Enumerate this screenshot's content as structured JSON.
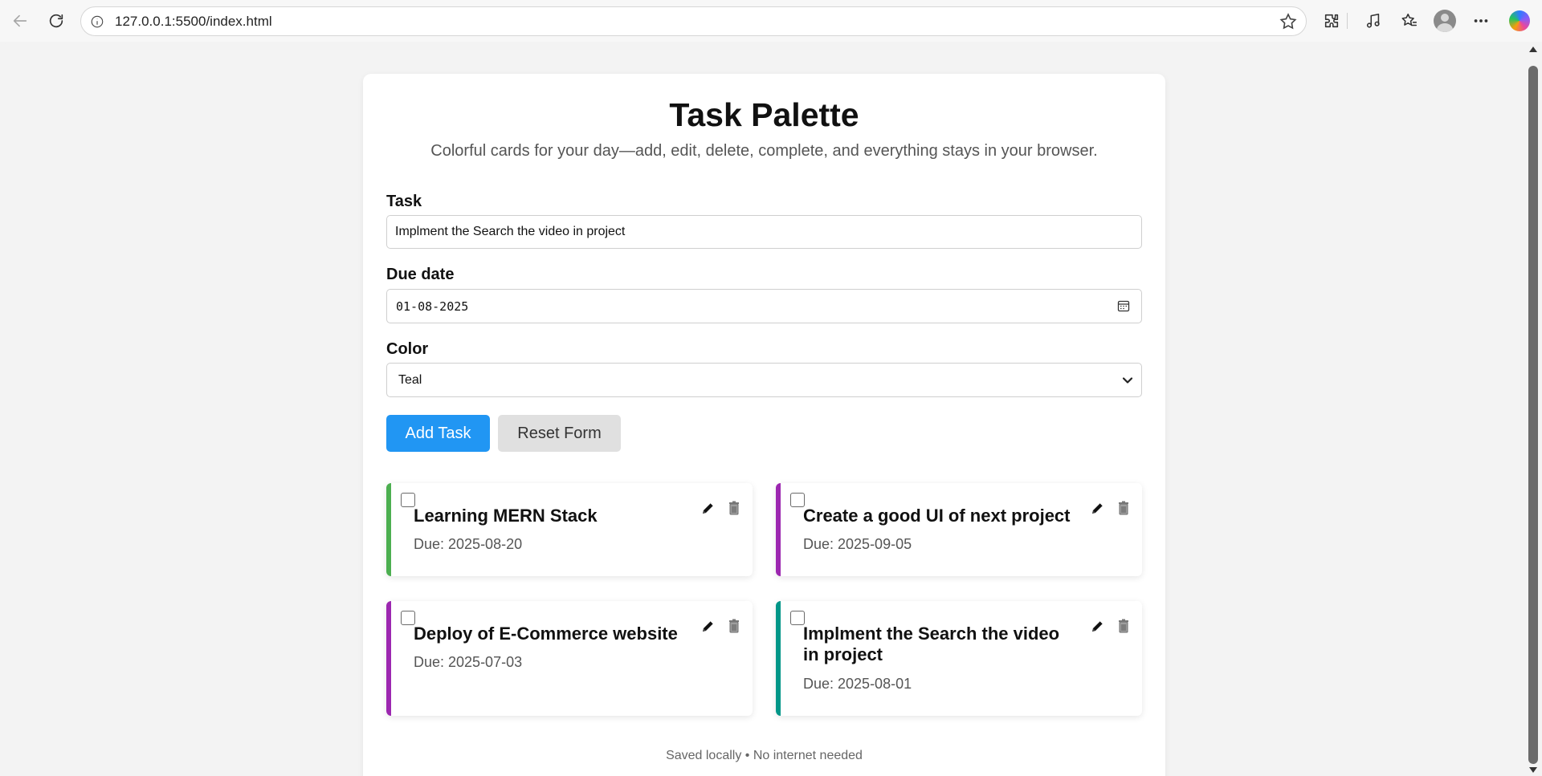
{
  "browser": {
    "url": "127.0.0.1:5500/index.html"
  },
  "app": {
    "title": "Task Palette",
    "subtitle": "Colorful cards for your day—add, edit, delete, complete, and everything stays in your browser.",
    "form": {
      "task_label": "Task",
      "task_value": "Implment the Search the video in project",
      "due_label": "Due date",
      "due_value": "01-08-2025",
      "color_label": "Color",
      "color_value": "Teal",
      "add_button": "Add Task",
      "reset_button": "Reset Form"
    },
    "tasks": [
      {
        "title": "Learning MERN Stack",
        "due": "Due: 2025-08-20",
        "color": "#4caf50",
        "completed": false
      },
      {
        "title": "Create a good UI of next project",
        "due": "Due: 2025-09-05",
        "color": "#9c27b0",
        "completed": false
      },
      {
        "title": "Deploy of E-Commerce website",
        "due": "Due: 2025-07-03",
        "color": "#9c27b0",
        "completed": false
      },
      {
        "title": "Implment the Search the video in project",
        "due": "Due: 2025-08-01",
        "color": "#009688",
        "completed": false
      }
    ],
    "footer": "Saved locally • No internet needed"
  },
  "colors": {
    "primary": "#2196f3",
    "reset": "#e0e0e0"
  }
}
